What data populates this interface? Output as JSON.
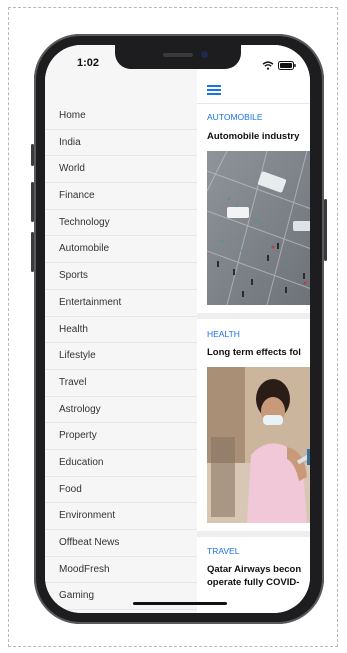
{
  "status_bar": {
    "time": "1:02"
  },
  "menu": {
    "items": [
      "Home",
      "India",
      "World",
      "Finance",
      "Technology",
      "Automobile",
      "Sports",
      "Entertainment",
      "Health",
      "Lifestyle",
      "Travel",
      "Astrology",
      "Property",
      "Education",
      "Food",
      "Environment",
      "Offbeat News",
      "MoodFresh",
      "Gaming"
    ]
  },
  "articles": [
    {
      "category": "AUTOMOBILE",
      "headline": "Automobile industry"
    },
    {
      "category": "HEALTH",
      "headline": "Long term effects fol"
    },
    {
      "category": "TRAVEL",
      "headline_line1": "Qatar Airways becon",
      "headline_line2": "operate fully COVID-"
    }
  ],
  "colors": {
    "accent": "#1a73e8",
    "menu_bg": "#f6f6f6"
  },
  "icons": {
    "menu": "hamburger-icon",
    "wifi": "wifi-icon",
    "battery": "battery-icon"
  }
}
